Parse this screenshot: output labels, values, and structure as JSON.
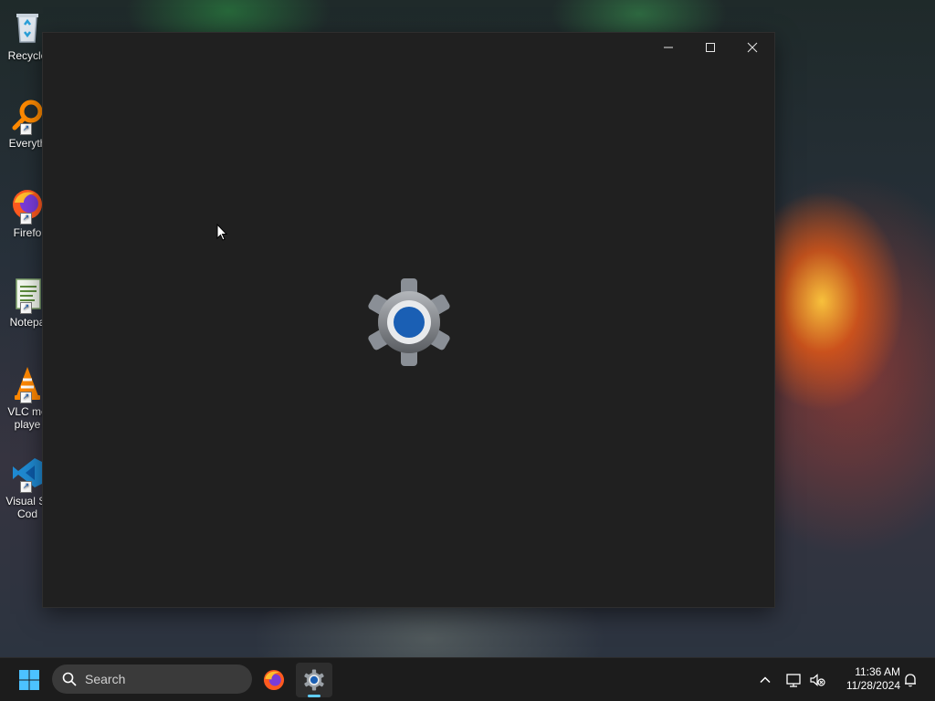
{
  "desktop": {
    "icons": [
      {
        "label": "Recycle",
        "icon": "recycle-bin-icon"
      },
      {
        "label": "Everyth",
        "icon": "everything-search-icon"
      },
      {
        "label": "Firefo",
        "icon": "firefox-icon"
      },
      {
        "label": "Notepa",
        "icon": "notepad-icon"
      },
      {
        "label": "VLC me",
        "label2": "playe",
        "icon": "vlc-icon"
      },
      {
        "label": "Visual St",
        "label2": "Cod",
        "icon": "vscode-icon"
      }
    ]
  },
  "window": {
    "app": "Settings",
    "state": "loading",
    "splash_icon": "settings-gear-icon",
    "controls": {
      "minimize": "—",
      "maximize": "☐",
      "close": "✕"
    }
  },
  "taskbar": {
    "search_placeholder": "Search",
    "pinned": [
      {
        "name": "Firefox",
        "icon": "firefox-icon"
      },
      {
        "name": "Settings",
        "icon": "settings-gear-icon",
        "active": true
      }
    ],
    "tray": {
      "chevron": "^",
      "icons": [
        "network-icon",
        "volume-muted-icon",
        "notification-bell-icon"
      ]
    },
    "clock": {
      "time": "11:36 AM",
      "date": "11/28/2024"
    }
  },
  "colors": {
    "window_bg": "#202020",
    "taskbar_bg": "#1c1c1c",
    "accent": "#60cdff",
    "gear_blue": "#1a5fb4"
  }
}
